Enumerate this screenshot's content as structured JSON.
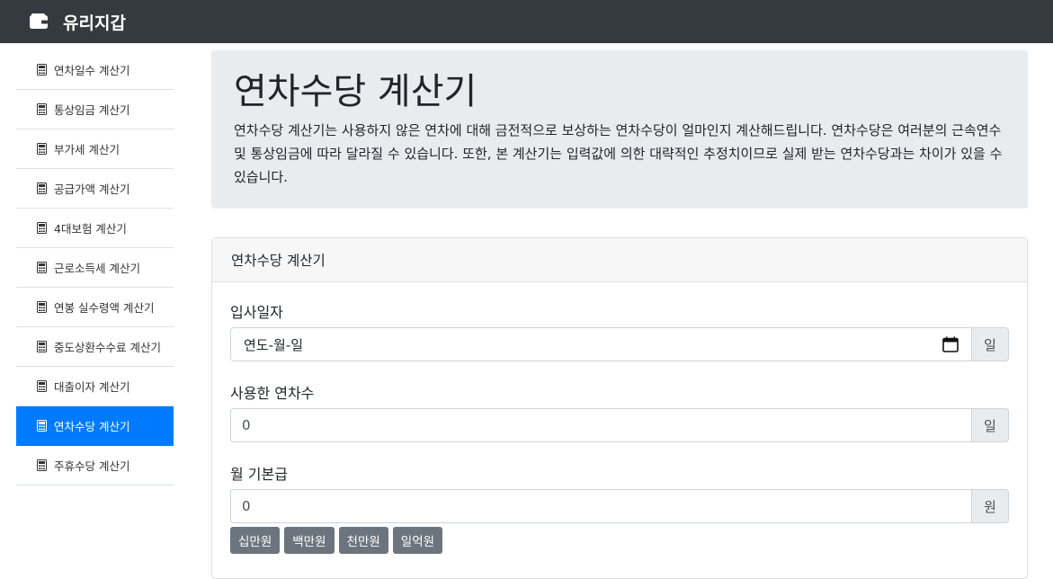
{
  "brand": {
    "title": "유리지갑",
    "icon": "wallet-icon"
  },
  "sidebar": {
    "icon": "calculator-icon",
    "items": [
      {
        "label": "연차일수 계산기",
        "active": false
      },
      {
        "label": "통상임금 계산기",
        "active": false
      },
      {
        "label": "부가세 계산기",
        "active": false
      },
      {
        "label": "공급가액 계산기",
        "active": false
      },
      {
        "label": "4대보험 계산기",
        "active": false
      },
      {
        "label": "근로소득세 계산기",
        "active": false
      },
      {
        "label": "연봉 실수령액 계산기",
        "active": false
      },
      {
        "label": "중도상환수수료 계산기",
        "active": false
      },
      {
        "label": "대출이자 계산기",
        "active": false
      },
      {
        "label": "연차수당 계산기",
        "active": true
      },
      {
        "label": "주휴수당 계산기",
        "active": false
      }
    ]
  },
  "jumbotron": {
    "title": "연차수당 계산기",
    "description": "연차수당 계산기는 사용하지 않은 연차에 대해 금전적으로 보상하는 연차수당이 얼마인지 계산해드립니다. 연차수당은 여러분의 근속연수 및 통상임금에 따라 달라질 수 있습니다. 또한, 본 계산기는 입력값에 의한 대략적인 추정치이므로 실제 받는 연차수당과는 차이가 있을 수 있습니다."
  },
  "form": {
    "header": "연차수당 계산기",
    "join_date": {
      "label": "입사일자",
      "placeholder": "연도-월-일",
      "addon": "일",
      "icon": "calendar-icon"
    },
    "used_leave": {
      "label": "사용한 연차수",
      "value": "0",
      "addon": "일"
    },
    "base_salary": {
      "label": "월 기본급",
      "value": "0",
      "addon": "원"
    },
    "quick_buttons": [
      "십만원",
      "백만원",
      "천만원",
      "일억원"
    ]
  },
  "colors": {
    "navbar": "#343a40",
    "accent": "#007bff",
    "secondary_button": "#6c757d"
  }
}
